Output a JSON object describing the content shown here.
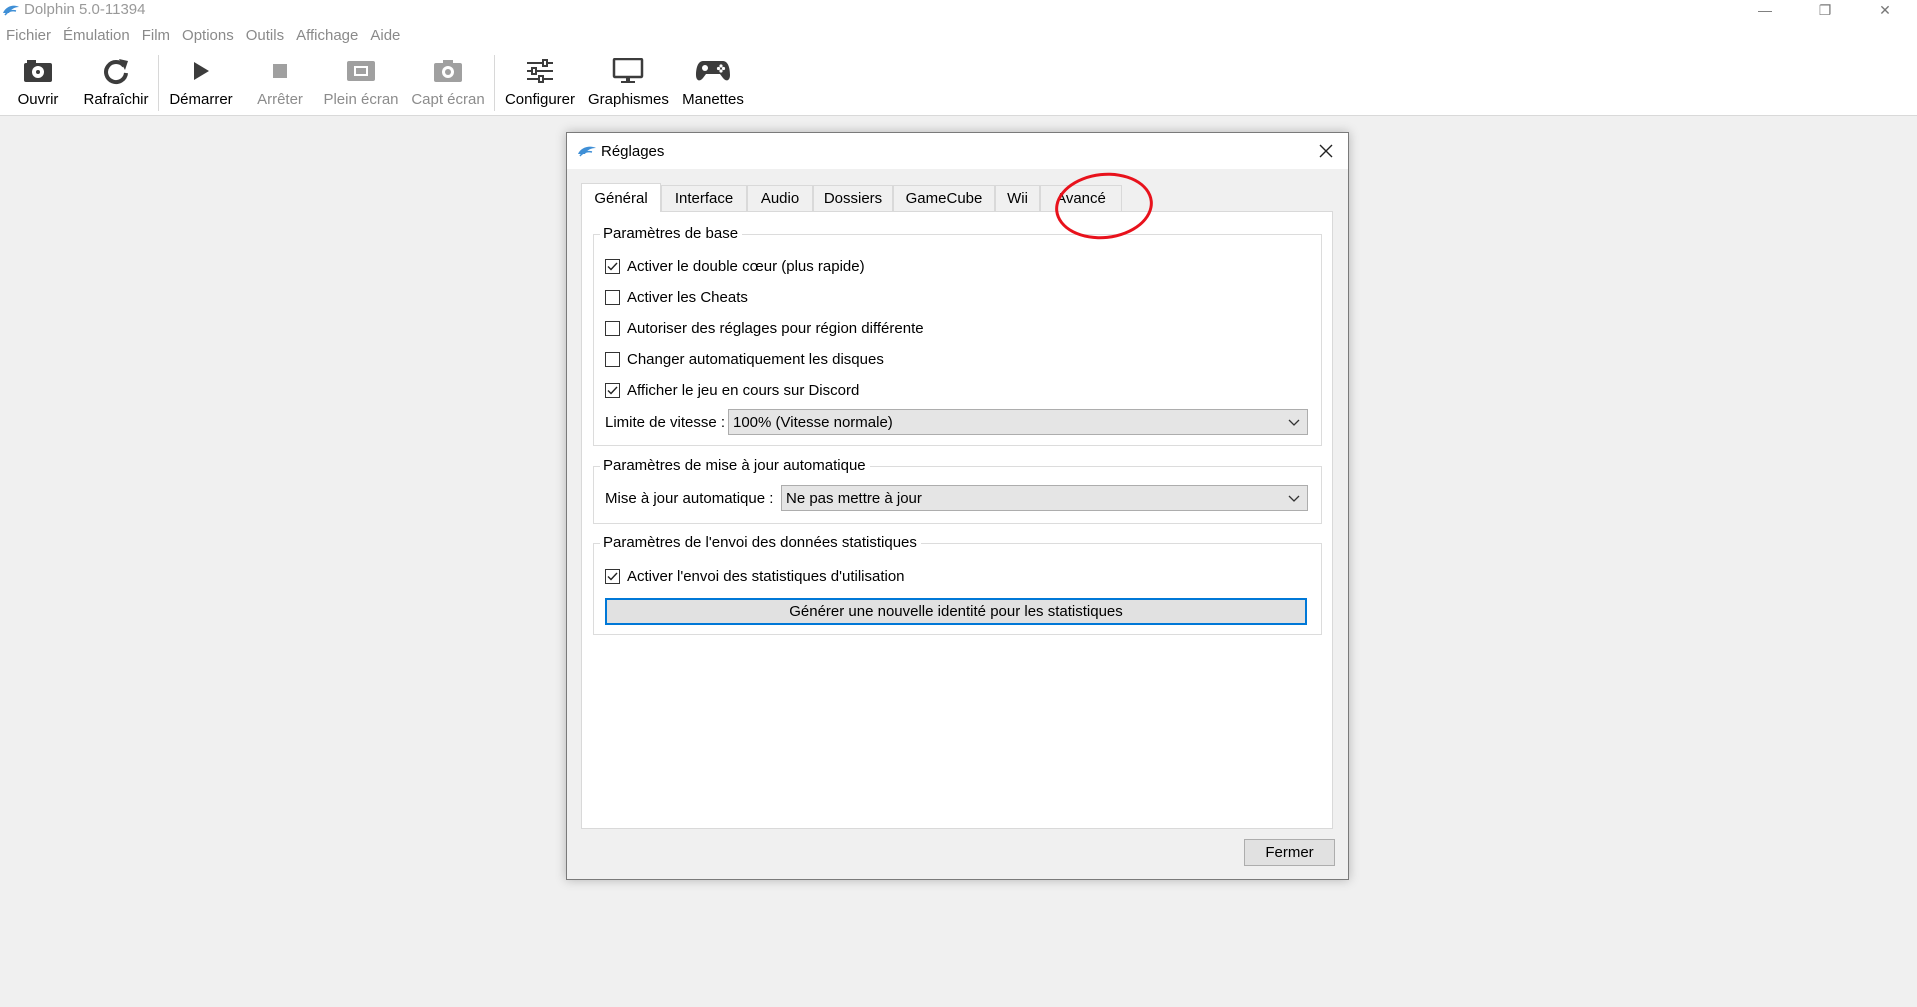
{
  "window": {
    "title": "Dolphin 5.0-11394",
    "minimize_glyph": "—",
    "restore_glyph": "❐",
    "close_glyph": "✕"
  },
  "menu": [
    "Fichier",
    "Émulation",
    "Film",
    "Options",
    "Outils",
    "Affichage",
    "Aide"
  ],
  "toolbar": {
    "open": "Ouvrir",
    "refresh": "Rafraîchir",
    "start": "Démarrer",
    "stop": "Arrêter",
    "fullscreen": "Plein écran",
    "screenshot": "Capt écran",
    "configure": "Configurer",
    "graphics": "Graphismes",
    "controllers": "Manettes"
  },
  "dialog": {
    "title": "Réglages",
    "tabs": [
      "Général",
      "Interface",
      "Audio",
      "Dossiers",
      "GameCube",
      "Wii",
      "Avancé"
    ],
    "active_tab": "Général",
    "basic": {
      "title": "Paramètres de base",
      "options": [
        {
          "label": "Activer le double cœur (plus rapide)",
          "checked": true
        },
        {
          "label": "Activer les Cheats",
          "checked": false
        },
        {
          "label": "Autoriser des réglages pour région différente",
          "checked": false
        },
        {
          "label": "Changer automatiquement les disques",
          "checked": false
        },
        {
          "label": "Afficher le jeu en cours sur Discord",
          "checked": true
        }
      ],
      "speed_label": "Limite de vitesse :",
      "speed_value": "100% (Vitesse normale)"
    },
    "update": {
      "title": "Paramètres de mise à jour automatique",
      "label": "Mise à jour automatique :",
      "value": "Ne pas mettre à jour"
    },
    "stats": {
      "title": "Paramètres de l'envoi des données statistiques",
      "option": {
        "label": "Activer l'envoi des statistiques d'utilisation",
        "checked": true
      },
      "button": "Générer une nouvelle identité pour les statistiques"
    },
    "close_button": "Fermer"
  },
  "colors": {
    "annotation": "#e8121c",
    "focus_border": "#0078d7"
  }
}
